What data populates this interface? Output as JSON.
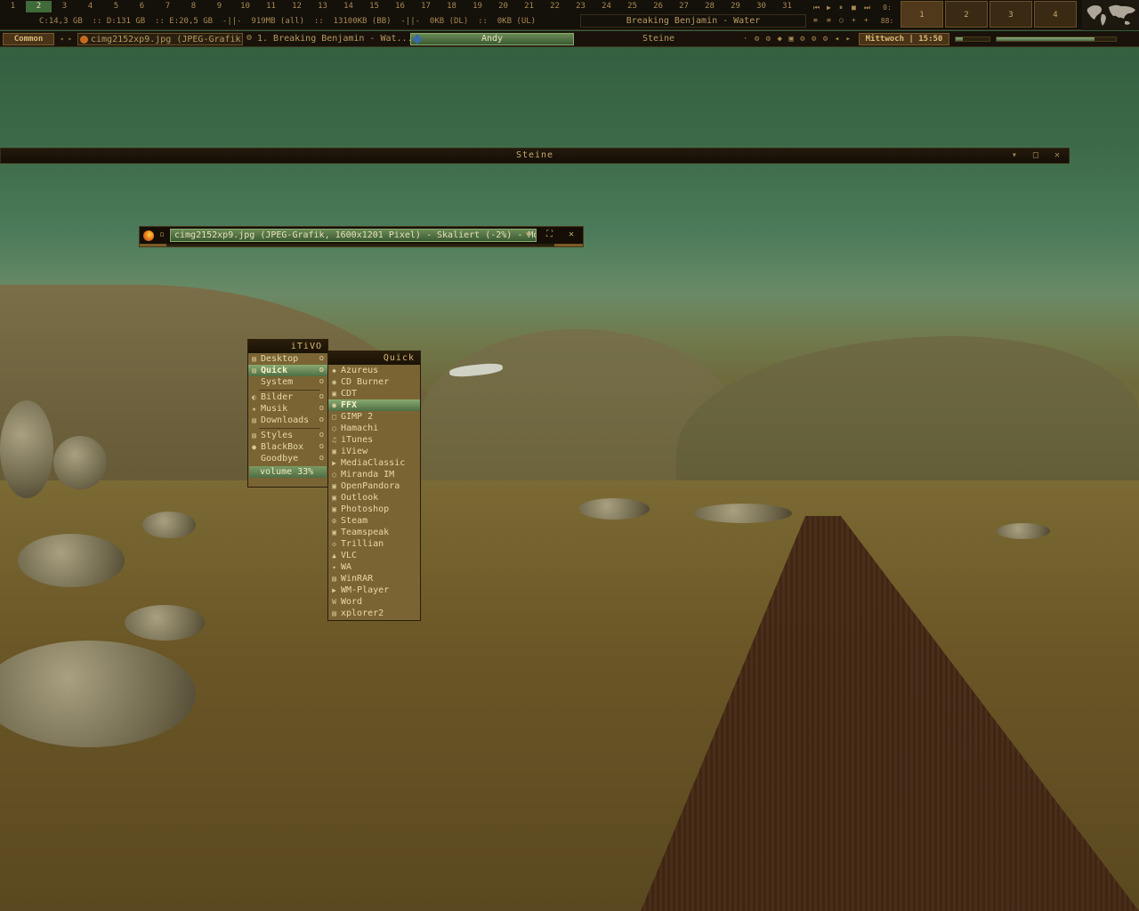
{
  "workspaces": [
    "1",
    "2",
    "3",
    "4",
    "5",
    "6",
    "7",
    "8",
    "9",
    "10",
    "11",
    "12",
    "13",
    "14",
    "15",
    "16",
    "17",
    "18",
    "19",
    "20",
    "21",
    "22",
    "23",
    "24",
    "25",
    "26",
    "27",
    "28",
    "29",
    "30",
    "31"
  ],
  "active_workspace_index": 1,
  "stats_text": "C:14,3 GB  :: D:131 GB  :: E:20,5 GB  -||-  919MB (all)  ::  13100KB (BB)  -||-  0KB (DL)  ::  0KB (UL)",
  "now_playing": "Breaking Benjamin - Water",
  "media_controls": [
    "⏮",
    "▶",
    "⏸",
    "■",
    "⏭"
  ],
  "media_extra": [
    "≡",
    "≡",
    "○",
    "+",
    "+"
  ],
  "clock_mini": [
    "0:",
    "88:"
  ],
  "pager": [
    "1",
    "2",
    "3",
    "4"
  ],
  "taskbar": {
    "common": "Common",
    "arrows": "◂ ▸",
    "task_1": "cimg2152xp9.jpg (JPEG-Grafik",
    "task_2": "1. Breaking Benjamin - Wat...",
    "user": "Andy",
    "window_title": "Steine",
    "tray": "· ⚙ ⚙ ◆ ▣ ⚙ ⚙ ⚙ ◂ ▸",
    "clock": "Mittwoch | 15:50"
  },
  "meters": [
    0.22,
    0.82
  ],
  "steine_window": {
    "title": "Steine",
    "buttons": "▾ □ ✕"
  },
  "firefox_window": {
    "title": "cimg2152xp9.jpg (JPEG-Grafik, 1600x1201 Pixel) - Skaliert (-2%) - Mo...",
    "minimize": "▫",
    "buttons": "▾ ⛶ ✕"
  },
  "main_menu": {
    "title": "iTiVO",
    "items": [
      {
        "label": "Desktop",
        "icon": "▤",
        "sub": "o"
      },
      {
        "label": "Quick",
        "icon": "▤",
        "sub": "o",
        "selected": true
      },
      {
        "label": "System",
        "icon": "",
        "sub": "o"
      },
      {
        "sep": true
      },
      {
        "label": "Bilder",
        "icon": "◐",
        "sub": "o"
      },
      {
        "label": "Musik",
        "icon": "★",
        "sub": "o"
      },
      {
        "label": "Downloads",
        "icon": "▤",
        "sub": "o"
      },
      {
        "sep": true
      },
      {
        "label": "Styles",
        "icon": "▤",
        "sub": "o"
      },
      {
        "label": "BlackBox",
        "icon": "●",
        "sub": "o"
      },
      {
        "label": "Goodbye",
        "icon": "",
        "sub": "o"
      }
    ],
    "volume": "volume 33%"
  },
  "quick_menu": {
    "title": "Quick",
    "items": [
      {
        "label": "Azureus",
        "icon": "◆"
      },
      {
        "label": "CD Burner",
        "icon": "◉"
      },
      {
        "label": "CDT",
        "icon": "▣"
      },
      {
        "label": "FFX",
        "icon": "●",
        "selected": true
      },
      {
        "label": "GIMP 2",
        "icon": "□"
      },
      {
        "label": "Hamachi",
        "icon": "○"
      },
      {
        "label": "iTunes",
        "icon": "♫"
      },
      {
        "label": "iView",
        "icon": "▣"
      },
      {
        "label": "MediaClassic",
        "icon": "▶"
      },
      {
        "label": "Miranda IM",
        "icon": "○"
      },
      {
        "label": "OpenPandora",
        "icon": "▣"
      },
      {
        "label": "Outlook",
        "icon": "▣"
      },
      {
        "label": "Photoshop",
        "icon": "▣"
      },
      {
        "label": "Steam",
        "icon": "⚙"
      },
      {
        "label": "Teamspeak",
        "icon": "▣"
      },
      {
        "label": "Trillian",
        "icon": "◇"
      },
      {
        "label": "VLC",
        "icon": "▲"
      },
      {
        "label": "WA",
        "icon": "✦"
      },
      {
        "label": "WinRAR",
        "icon": "▤"
      },
      {
        "label": "WM-Player",
        "icon": "▶"
      },
      {
        "label": "Word",
        "icon": "W"
      },
      {
        "label": "xplorer2",
        "icon": "▤"
      }
    ]
  }
}
